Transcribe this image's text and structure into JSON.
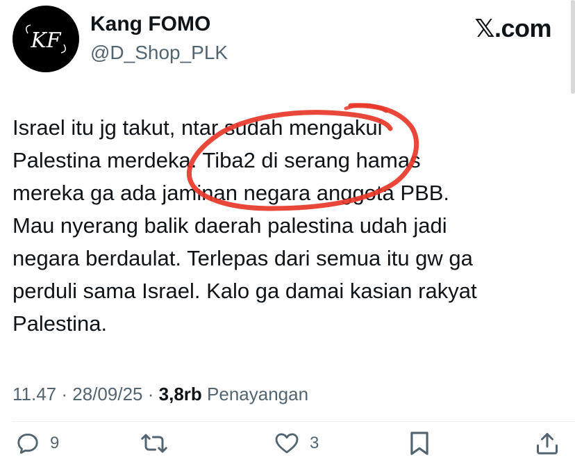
{
  "author": {
    "avatar_text": "KF",
    "name": "Kang FOMO",
    "handle": "@D_Shop_PLK"
  },
  "brand": "𝕏.com",
  "tweet": {
    "lines": [
      "Israel itu jg takut, ntar sudah mengakui",
      "Palestina merdeka. Tiba2 di serang hamas",
      "mereka ga ada jaminan negara anggota PBB.",
      "Mau nyerang balik daerah palestina udah jadi",
      "negara berdaulat. Terlepas dari semua itu gw ga",
      "perduli sama Israel. Kalo ga damai kasian rakyat",
      "Palestina."
    ]
  },
  "meta": {
    "time": "11.47",
    "separator": "·",
    "date": "28/09/25",
    "views_count": "3,8rb",
    "views_label": "Penayangan"
  },
  "actions": {
    "replies": {
      "icon": "reply-icon",
      "count": "9"
    },
    "reposts": {
      "icon": "repost-icon",
      "count": ""
    },
    "likes": {
      "icon": "heart-icon",
      "count": "3"
    },
    "bookmark": {
      "icon": "bookmark-icon"
    },
    "share": {
      "icon": "share-icon"
    }
  },
  "colors": {
    "text": "#0f1419",
    "secondary": "#536471",
    "scribble": "#e8372a"
  }
}
